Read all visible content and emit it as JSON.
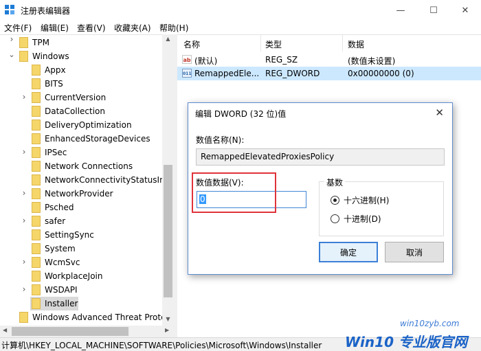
{
  "window": {
    "title": "注册表编辑器",
    "minimize": "—",
    "maximize": "☐",
    "close": "✕"
  },
  "menu": [
    "文件(F)",
    "编辑(E)",
    "查看(V)",
    "收藏夹(A)",
    "帮助(H)"
  ],
  "tree": [
    {
      "label": "TPM",
      "indent": 1,
      "expander": "none"
    },
    {
      "label": "Windows",
      "indent": 1,
      "expander": "expanded"
    },
    {
      "label": "Appx",
      "indent": 2,
      "expander": "none"
    },
    {
      "label": "BITS",
      "indent": 2,
      "expander": "none"
    },
    {
      "label": "CurrentVersion",
      "indent": 2,
      "expander": "collapsed"
    },
    {
      "label": "DataCollection",
      "indent": 2,
      "expander": "none"
    },
    {
      "label": "DeliveryOptimization",
      "indent": 2,
      "expander": "none"
    },
    {
      "label": "EnhancedStorageDevices",
      "indent": 2,
      "expander": "none"
    },
    {
      "label": "IPSec",
      "indent": 2,
      "expander": "collapsed"
    },
    {
      "label": "Network Connections",
      "indent": 2,
      "expander": "none"
    },
    {
      "label": "NetworkConnectivityStatusInc",
      "indent": 2,
      "expander": "none"
    },
    {
      "label": "NetworkProvider",
      "indent": 2,
      "expander": "collapsed"
    },
    {
      "label": "Psched",
      "indent": 2,
      "expander": "none"
    },
    {
      "label": "safer",
      "indent": 2,
      "expander": "collapsed"
    },
    {
      "label": "SettingSync",
      "indent": 2,
      "expander": "none"
    },
    {
      "label": "System",
      "indent": 2,
      "expander": "none"
    },
    {
      "label": "WcmSvc",
      "indent": 2,
      "expander": "collapsed"
    },
    {
      "label": "WorkplaceJoin",
      "indent": 2,
      "expander": "none"
    },
    {
      "label": "WSDAPI",
      "indent": 2,
      "expander": "collapsed"
    },
    {
      "label": "Installer",
      "indent": 2,
      "expander": "none",
      "selected": true
    },
    {
      "label": "Windows Advanced Threat Prote",
      "indent": 1,
      "expander": "none"
    }
  ],
  "list": {
    "headers": [
      "名称",
      "类型",
      "数据"
    ],
    "rows": [
      {
        "icon": "ab",
        "name": "(默认)",
        "type": "REG_SZ",
        "data": "(数值未设置)",
        "selected": false
      },
      {
        "icon": "bin",
        "name": "RemappedEle...",
        "type": "REG_DWORD",
        "data": "0x00000000 (0)",
        "selected": true
      }
    ]
  },
  "icons": {
    "ab": "ab",
    "bin": "011"
  },
  "status": "计算机\\HKEY_LOCAL_MACHINE\\SOFTWARE\\Policies\\Microsoft\\Windows\\Installer",
  "dialog": {
    "title": "编辑 DWORD (32 位)值",
    "close": "✕",
    "name_label": "数值名称(N):",
    "name_value": "RemappedElevatedProxiesPolicy",
    "data_label": "数值数据(V):",
    "data_value": "0",
    "base_label": "基数",
    "radio_hex": "十六进制(H)",
    "radio_dec": "十进制(D)",
    "base_selected": "hex",
    "ok": "确定",
    "cancel": "取消"
  },
  "watermark": {
    "logo": "Win10 专业版官网",
    "url": "win10zyb.com"
  },
  "colors": {
    "accent": "#3c7fd6",
    "selection": "#cce8ff",
    "highlight_box": "#e0323a"
  }
}
